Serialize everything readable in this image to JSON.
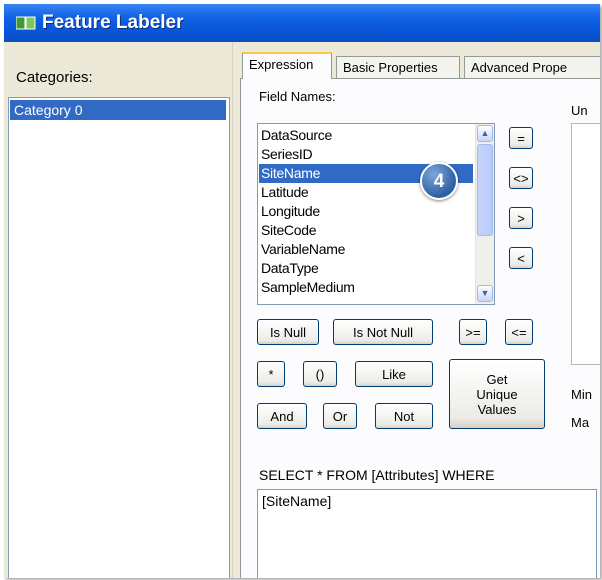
{
  "window": {
    "title": "Feature Labeler",
    "icon": "feature-labeler-app-icon"
  },
  "categories": {
    "label": "Categories:",
    "items": [
      "Category 0"
    ]
  },
  "tabs": [
    {
      "label": "Expression",
      "active": true
    },
    {
      "label": "Basic Properties",
      "active": false
    },
    {
      "label": "Advanced Prope",
      "active": false
    }
  ],
  "expression": {
    "field_names_label": "Field Names:",
    "fields": [
      "DataSource",
      "SeriesID",
      "SiteName",
      "Latitude",
      "Longitude",
      "SiteCode",
      "VariableName",
      "DataType",
      "SampleMedium"
    ],
    "selected_field": "SiteName",
    "callout_number": "4",
    "operators": {
      "equal": "=",
      "not_equal": "<>",
      "greater": ">",
      "less": "<",
      "is_null": "Is Null",
      "is_not_null": "Is Not Null",
      "gte": ">=",
      "lte": "<=",
      "wildcard": "*",
      "parens": "()",
      "like": "Like",
      "and": "And",
      "or": "Or",
      "not": "Not",
      "get_unique_values": "Get Unique Values"
    },
    "sql_prefix": "SELECT * FROM [Attributes] WHERE",
    "sql_text": "[SiteName]",
    "right_labels": {
      "top": "Un",
      "min": "Min",
      "max": "Ma"
    }
  }
}
